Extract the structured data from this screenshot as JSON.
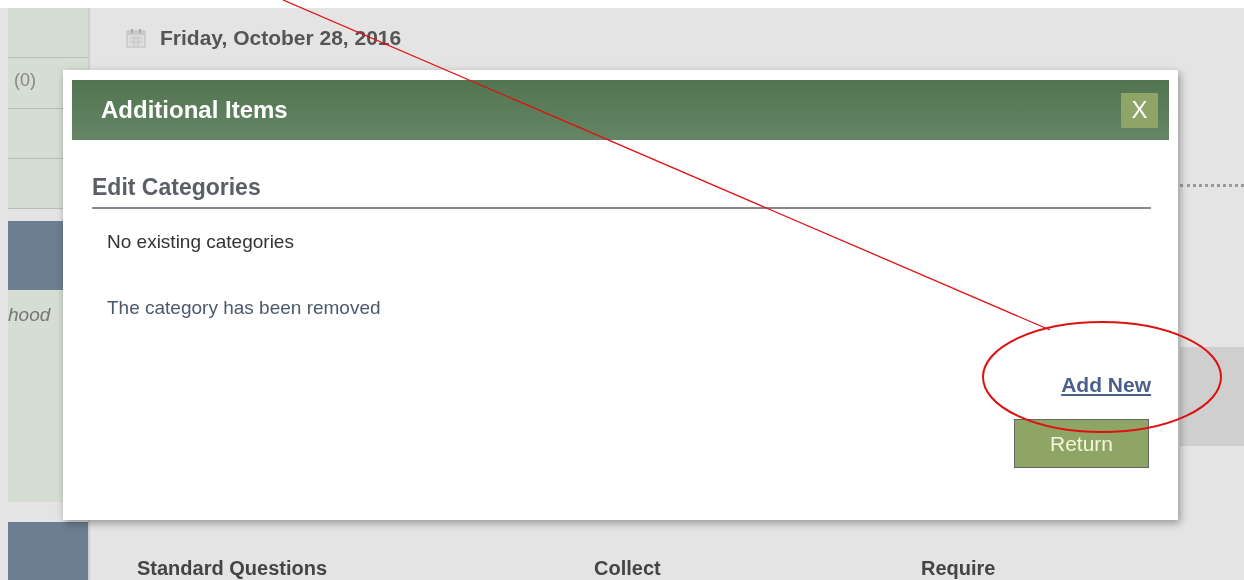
{
  "sidebar": {
    "items": [
      {
        "kind": "blank"
      },
      {
        "kind": "count",
        "text": "(0)"
      },
      {
        "kind": "blank"
      },
      {
        "kind": "blank"
      },
      {
        "kind": "dark"
      },
      {
        "kind": "note",
        "text": "hood"
      },
      {
        "kind": "plain"
      }
    ]
  },
  "page": {
    "date": "Friday, October 28, 2016",
    "columns": [
      "Standard Questions",
      "Collect",
      "Require"
    ]
  },
  "dialog": {
    "title": "Additional Items",
    "close": "X",
    "section": "Edit Categories",
    "messages": [
      "No existing categories",
      "The category has been removed"
    ],
    "link": "Add New",
    "button": "Return"
  }
}
